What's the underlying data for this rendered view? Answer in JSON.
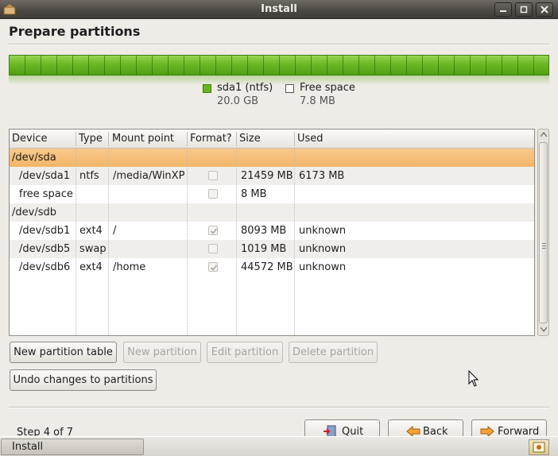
{
  "window": {
    "title": "Install",
    "buttons": {
      "minimize": "_",
      "maximize": "□",
      "close": "×"
    }
  },
  "page": {
    "heading": "Prepare partitions"
  },
  "legend": [
    {
      "name": "sda1 (ntfs)",
      "size": "20.0 GB",
      "color": "#66b51f"
    },
    {
      "name": "Free space",
      "size": "7.8 MB",
      "color": "#ffffff"
    }
  ],
  "table": {
    "columns": [
      "Device",
      "Type",
      "Mount point",
      "Format?",
      "Size",
      "Used"
    ],
    "rows": [
      {
        "device": "/dev/sda",
        "type": "",
        "mount": "",
        "format": null,
        "size": "",
        "used": ""
      },
      {
        "device": "/dev/sda1",
        "type": "ntfs",
        "mount": "/media/WinXP",
        "format": false,
        "size": "21459 MB",
        "used": "6173 MB"
      },
      {
        "device": "free space",
        "type": "",
        "mount": "",
        "format": false,
        "size": "8 MB",
        "used": ""
      },
      {
        "device": "/dev/sdb",
        "type": "",
        "mount": "",
        "format": null,
        "size": "",
        "used": ""
      },
      {
        "device": "/dev/sdb1",
        "type": "ext4",
        "mount": "/",
        "format": true,
        "size": "8093 MB",
        "used": "unknown"
      },
      {
        "device": "/dev/sdb5",
        "type": "swap",
        "mount": "",
        "format": false,
        "size": "1019 MB",
        "used": "unknown"
      },
      {
        "device": "/dev/sdb6",
        "type": "ext4",
        "mount": "/home",
        "format": true,
        "size": "44572 MB",
        "used": "unknown"
      }
    ],
    "selected_row": "/dev/sda"
  },
  "actions": {
    "new_partition_table": "New partition table",
    "new_partition": "New partition",
    "edit_partition": "Edit partition",
    "delete_partition": "Delete partition",
    "undo_changes": "Undo changes to partitions"
  },
  "footer": {
    "step": "Step 4 of 7",
    "quit": "Quit",
    "back": "Back",
    "forward": "Forward"
  },
  "taskbar": {
    "task_label": "Install"
  },
  "colors": {
    "selection": "#f3b567",
    "partition_green": "#66b51f"
  }
}
